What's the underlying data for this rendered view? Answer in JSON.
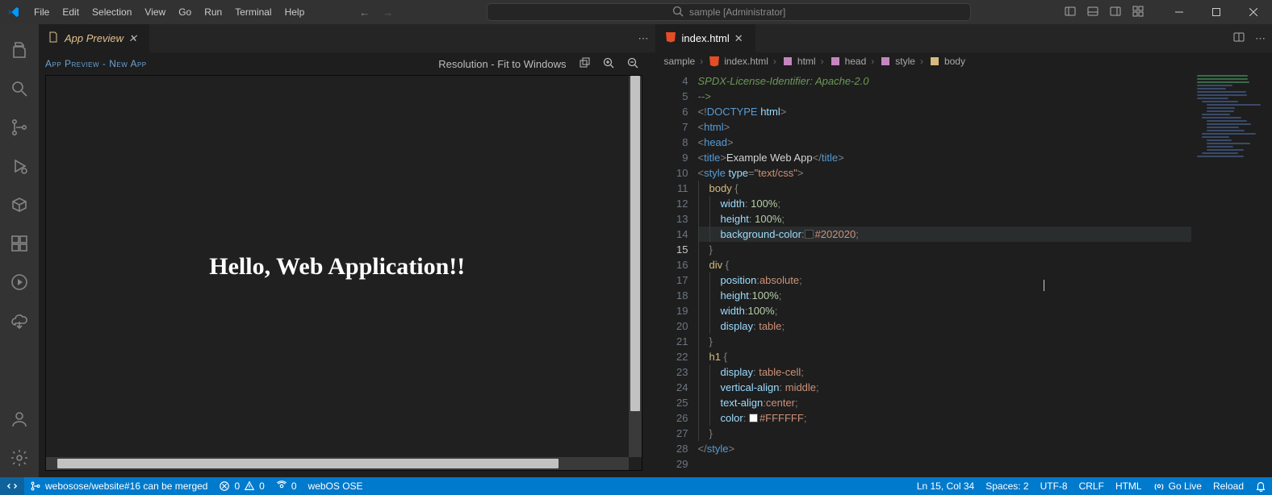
{
  "menu": [
    "File",
    "Edit",
    "Selection",
    "View",
    "Go",
    "Run",
    "Terminal",
    "Help"
  ],
  "command_center": "sample [Administrator]",
  "tabs_left": {
    "label": "App Preview"
  },
  "tabs_right": {
    "label": "index.html"
  },
  "preview": {
    "title": "App Preview - New App",
    "resolution_label": "Resolution - Fit to Windows",
    "heading": "Hello, Web Application!!"
  },
  "breadcrumbs": [
    "sample",
    "index.html",
    "html",
    "head",
    "style",
    "body"
  ],
  "gutter_start": 4,
  "code_lines": [
    {
      "n": 4,
      "indent": 0,
      "html": "<span class='tok-comment'>SPDX-License-Identifier: Apache-2.0</span>"
    },
    {
      "n": 5,
      "indent": 0,
      "html": "<span class='tok-comment'>--&gt;</span>"
    },
    {
      "n": 6,
      "indent": 0,
      "html": ""
    },
    {
      "n": 7,
      "indent": 0,
      "html": "<span class='tok-punct'>&lt;!</span><span class='tok-tag'>DOCTYPE</span> <span class='tok-attr'>html</span><span class='tok-punct'>&gt;</span>"
    },
    {
      "n": 8,
      "indent": 0,
      "html": "<span class='tok-punct'>&lt;</span><span class='tok-tag'>html</span><span class='tok-punct'>&gt;</span>"
    },
    {
      "n": 9,
      "indent": 0,
      "html": "<span class='tok-punct'>&lt;</span><span class='tok-tag'>head</span><span class='tok-punct'>&gt;</span>"
    },
    {
      "n": 10,
      "indent": 0,
      "html": "<span class='tok-punct'>&lt;</span><span class='tok-tag'>title</span><span class='tok-punct'>&gt;</span><span class='tok-text'>Example Web App</span><span class='tok-punct'>&lt;/</span><span class='tok-tag'>title</span><span class='tok-punct'>&gt;</span>"
    },
    {
      "n": 11,
      "indent": 0,
      "html": "<span class='tok-punct'>&lt;</span><span class='tok-tag'>style</span> <span class='tok-attr'>type</span><span class='tok-punct'>=</span><span class='tok-str'>\"text/css\"</span><span class='tok-punct'>&gt;</span>"
    },
    {
      "n": 12,
      "indent": 1,
      "html": "<span class='tok-sel'>body</span> <span class='tok-punct'>{</span>"
    },
    {
      "n": 13,
      "indent": 2,
      "html": "<span class='tok-prop'>width</span><span class='tok-punct'>:</span> <span class='tok-num'>100%</span><span class='tok-punct'>;</span>"
    },
    {
      "n": 14,
      "indent": 2,
      "html": "<span class='tok-prop'>height</span><span class='tok-punct'>:</span> <span class='tok-num'>100%</span><span class='tok-punct'>;</span>"
    },
    {
      "n": 15,
      "indent": 2,
      "current": true,
      "html": "<span class='tok-prop'>background-color</span><span class='tok-punct'>:</span><span class='swatch' style='background:#202020'></span><span class='tok-val'>#202020</span><span class='tok-punct'>;</span>"
    },
    {
      "n": 16,
      "indent": 1,
      "html": "<span class='tok-punct'>}</span>"
    },
    {
      "n": 17,
      "indent": 1,
      "html": "<span class='tok-sel'>div</span> <span class='tok-punct'>{</span>"
    },
    {
      "n": 18,
      "indent": 2,
      "html": "<span class='tok-prop'>position</span><span class='tok-punct'>:</span><span class='tok-val'>absolute</span><span class='tok-punct'>;</span>"
    },
    {
      "n": 19,
      "indent": 2,
      "html": "<span class='tok-prop'>height</span><span class='tok-punct'>:</span><span class='tok-num'>100%</span><span class='tok-punct'>;</span>"
    },
    {
      "n": 20,
      "indent": 2,
      "html": "<span class='tok-prop'>width</span><span class='tok-punct'>:</span><span class='tok-num'>100%</span><span class='tok-punct'>;</span>"
    },
    {
      "n": 21,
      "indent": 2,
      "html": "<span class='tok-prop'>display</span><span class='tok-punct'>:</span> <span class='tok-val'>table</span><span class='tok-punct'>;</span>"
    },
    {
      "n": 22,
      "indent": 1,
      "html": "<span class='tok-punct'>}</span>"
    },
    {
      "n": 23,
      "indent": 1,
      "html": "<span class='tok-sel'>h1</span> <span class='tok-punct'>{</span>"
    },
    {
      "n": 24,
      "indent": 2,
      "html": "<span class='tok-prop'>display</span><span class='tok-punct'>:</span> <span class='tok-val'>table-cell</span><span class='tok-punct'>;</span>"
    },
    {
      "n": 25,
      "indent": 2,
      "html": "<span class='tok-prop'>vertical-align</span><span class='tok-punct'>:</span> <span class='tok-val'>middle</span><span class='tok-punct'>;</span>"
    },
    {
      "n": 26,
      "indent": 2,
      "html": "<span class='tok-prop'>text-align</span><span class='tok-punct'>:</span><span class='tok-val'>center</span><span class='tok-punct'>;</span>"
    },
    {
      "n": 27,
      "indent": 2,
      "html": "<span class='tok-prop'>color</span><span class='tok-punct'>:</span> <span class='swatch' style='background:#FFFFFF'></span><span class='tok-val'>#FFFFFF</span><span class='tok-punct'>;</span>"
    },
    {
      "n": 28,
      "indent": 1,
      "html": "<span class='tok-punct'>}</span>"
    },
    {
      "n": 29,
      "indent": 0,
      "html": "<span class='tok-punct'>&lt;/</span><span class='tok-tag'>style</span><span class='tok-punct'>&gt;</span>"
    }
  ],
  "status": {
    "branch": "webosose/website#16 can be merged",
    "errors": "0",
    "warnings": "0",
    "ports": "0",
    "sdk": "webOS OSE",
    "cursorpos": "Ln 15, Col 34",
    "spaces": "Spaces: 2",
    "encoding": "UTF-8",
    "eol": "CRLF",
    "lang": "HTML",
    "golive": "Go Live",
    "reload": "Reload"
  }
}
